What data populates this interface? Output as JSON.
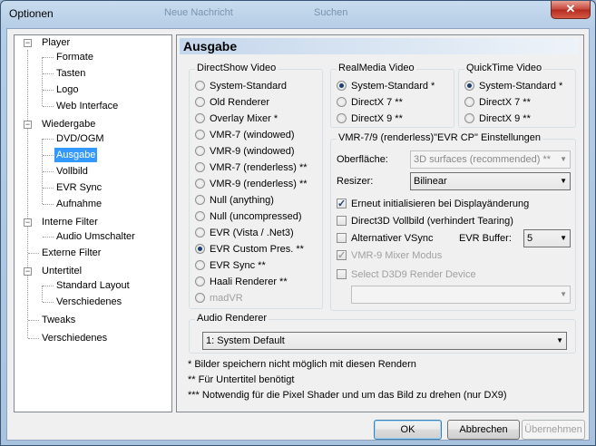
{
  "window": {
    "title": "Optionen",
    "close": "✕"
  },
  "tree": [
    {
      "label": "Player",
      "level": 0,
      "expander": "-"
    },
    {
      "label": "Formate",
      "level": 1
    },
    {
      "label": "Tasten",
      "level": 1
    },
    {
      "label": "Logo",
      "level": 1
    },
    {
      "label": "Web Interface",
      "level": 1
    },
    {
      "label": "Wiedergabe",
      "level": 0,
      "expander": "-"
    },
    {
      "label": "DVD/OGM",
      "level": 1
    },
    {
      "label": "Ausgabe",
      "level": 1,
      "selected": true
    },
    {
      "label": "Vollbild",
      "level": 1
    },
    {
      "label": "EVR Sync",
      "level": 1
    },
    {
      "label": "Aufnahme",
      "level": 1
    },
    {
      "label": "Interne Filter",
      "level": 0,
      "expander": "-"
    },
    {
      "label": "Audio Umschalter",
      "level": 1
    },
    {
      "label": "Externe Filter",
      "level": 0
    },
    {
      "label": "Untertitel",
      "level": 0,
      "expander": "-"
    },
    {
      "label": "Standard Layout",
      "level": 1
    },
    {
      "label": "Verschiedenes",
      "level": 1
    },
    {
      "label": "Tweaks",
      "level": 0
    },
    {
      "label": "Verschiedenes",
      "level": 0
    }
  ],
  "page": {
    "title": "Ausgabe",
    "directshow": {
      "label": "DirectShow Video",
      "options": [
        {
          "label": "System-Standard"
        },
        {
          "label": "Old Renderer"
        },
        {
          "label": "Overlay Mixer *"
        },
        {
          "label": "VMR-7 (windowed)"
        },
        {
          "label": "VMR-9 (windowed)"
        },
        {
          "label": "VMR-7 (renderless) **"
        },
        {
          "label": "VMR-9 (renderless) **"
        },
        {
          "label": "Null (anything)"
        },
        {
          "label": "Null (uncompressed)"
        },
        {
          "label": "EVR (Vista / .Net3)"
        },
        {
          "label": "EVR Custom Pres. **",
          "checked": true
        },
        {
          "label": "EVR Sync **"
        },
        {
          "label": "Haali Renderer **"
        },
        {
          "label": "madVR",
          "disabled": true
        }
      ]
    },
    "realmedia": {
      "label": "RealMedia Video",
      "options": [
        {
          "label": "System-Standard *",
          "checked": true
        },
        {
          "label": "DirectX 7 **"
        },
        {
          "label": "DirectX 9 **"
        }
      ]
    },
    "quicktime": {
      "label": "QuickTime Video",
      "options": [
        {
          "label": "System-Standard *",
          "checked": true
        },
        {
          "label": "DirectX 7 **"
        },
        {
          "label": "DirectX 9 **"
        }
      ]
    },
    "vmr": {
      "label": "VMR-7/9 (renderless)\"EVR CP\" Einstellungen",
      "surface_label": "Oberfläche:",
      "surface_value": "3D surfaces (recommended) **",
      "resizer_label": "Resizer:",
      "resizer_value": "Bilinear",
      "reinit": "Erneut initialisieren bei Displayänderung",
      "d3d_fullscreen": "Direct3D Vollbild (verhindert Tearing)",
      "vsync": "Alternativer VSync",
      "evr_buffer_label": "EVR Buffer:",
      "evr_buffer_value": "5",
      "vmr9_mixer": "VMR-9 Mixer Modus",
      "d3d9_device": "Select D3D9 Render Device",
      "d3d9_device_value": ""
    },
    "audio": {
      "label": "Audio Renderer",
      "value": "1: System Default"
    },
    "notes": [
      "* Bilder speichern nicht möglich mit diesen Rendern",
      "** Für Untertitel benötigt",
      "*** Notwendig für die Pixel Shader und um das Bild zu drehen (nur DX9)"
    ]
  },
  "buttons": {
    "ok": "OK",
    "cancel": "Abbrechen",
    "apply": "Übernehmen"
  },
  "background_titles": [
    "Neue Nachricht",
    "Suchen"
  ]
}
